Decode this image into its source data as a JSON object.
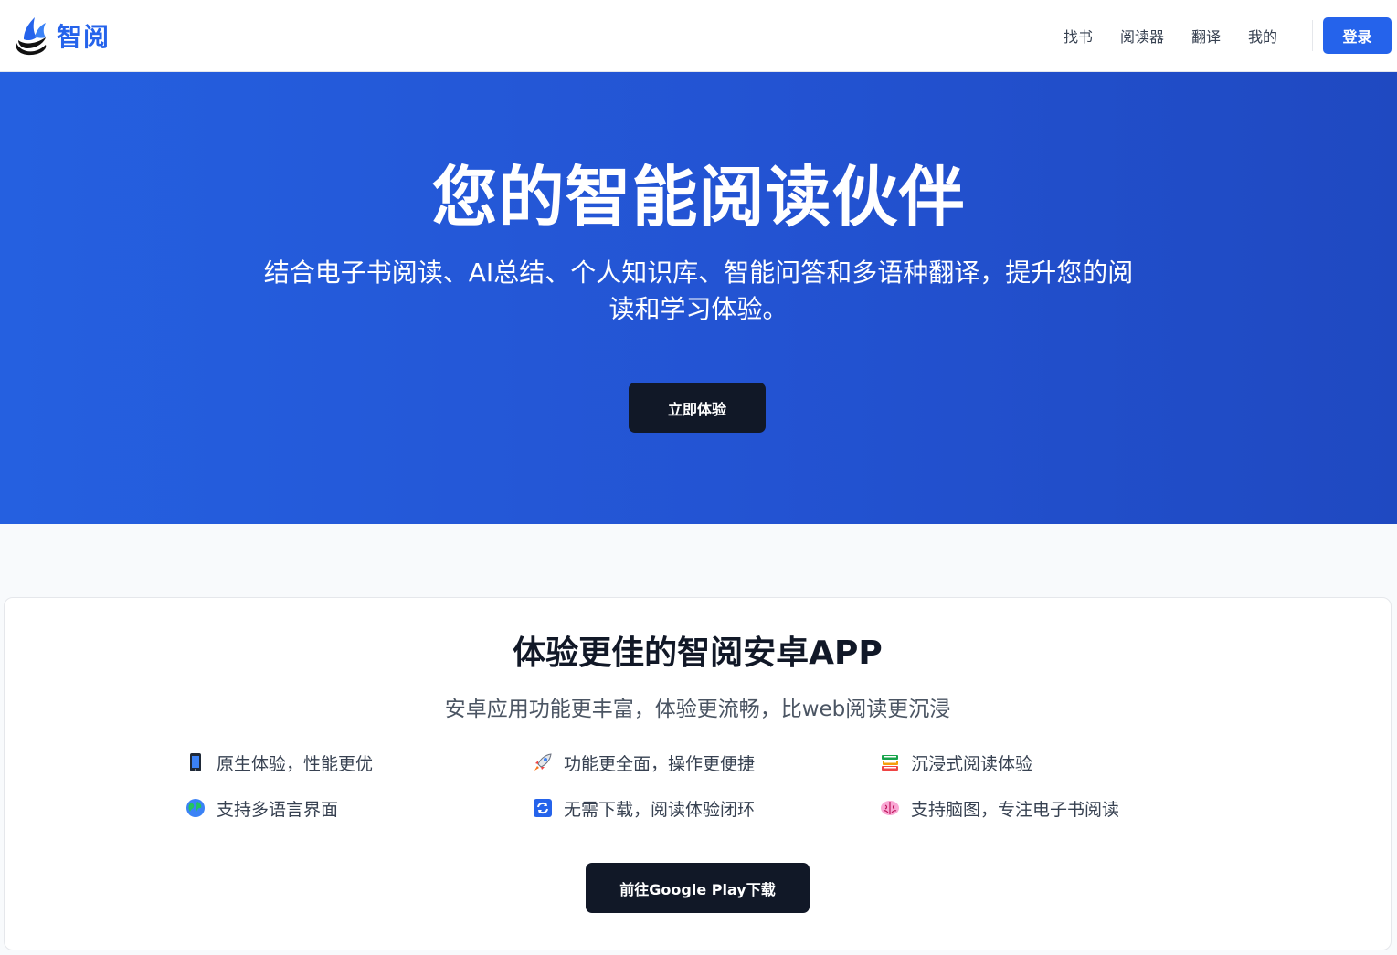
{
  "header": {
    "brand_name": "智阅",
    "nav": [
      {
        "label": "找书"
      },
      {
        "label": "阅读器"
      },
      {
        "label": "翻译"
      },
      {
        "label": "我的"
      }
    ],
    "login_label": "登录"
  },
  "hero": {
    "title": "您的智能阅读伙伴",
    "subtitle": "结合电子书阅读、AI总结、个人知识库、智能问答和多语种翻译，提升您的阅读和学习体验。",
    "cta_label": "立即体验"
  },
  "app_section": {
    "title": "体验更佳的智阅安卓APP",
    "subtitle": "安卓应用功能更丰富，体验更流畅，比web阅读更沉浸",
    "features": [
      {
        "icon": "mobile-phone-icon",
        "text": "原生体验，性能更优"
      },
      {
        "icon": "rocket-icon",
        "text": "功能更全面，操作更便捷"
      },
      {
        "icon": "books-icon",
        "text": "沉浸式阅读体验"
      },
      {
        "icon": "globe-icon",
        "text": "支持多语言界面"
      },
      {
        "icon": "sync-arrows-icon",
        "text": "无需下载，阅读体验闭环"
      },
      {
        "icon": "brain-icon",
        "text": "支持脑图，专注电子书阅读"
      }
    ],
    "download_label": "前往Google Play下载"
  },
  "colors": {
    "brand": "#2563eb",
    "hero_gradient_start": "#2560e0",
    "hero_gradient_end": "#1f49c1",
    "dark_button": "#111827"
  }
}
